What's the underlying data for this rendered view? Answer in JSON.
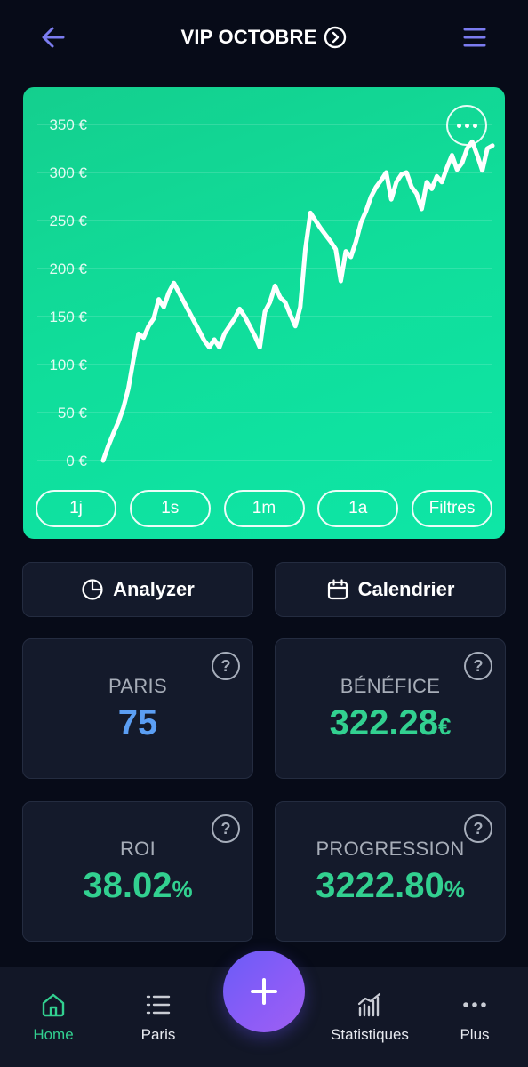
{
  "header": {
    "title": "VIP OCTOBRE",
    "back_icon": "arrow-left-icon",
    "title_icon": "chevron-right-circle-icon",
    "menu_icon": "menu-icon",
    "accent_color": "#7b7cf0"
  },
  "chart_data": {
    "type": "line",
    "title": "",
    "xlabel": "",
    "ylabel": "",
    "ylim": [
      0,
      350
    ],
    "y_ticks": [
      "0 €",
      "50 €",
      "100 €",
      "150 €",
      "200 €",
      "250 €",
      "300 €",
      "350 €"
    ],
    "grid": true,
    "line_color": "#ffffff",
    "background_color": "#10dd9a",
    "series": [
      {
        "values": [
          0,
          15,
          28,
          40,
          55,
          75,
          105,
          132,
          128,
          140,
          148,
          168,
          160,
          175,
          185,
          175,
          165,
          155,
          145,
          135,
          125,
          118,
          126,
          118,
          132,
          140,
          148,
          158,
          150,
          140,
          130,
          118,
          155,
          165,
          182,
          170,
          165,
          152,
          140,
          160,
          220,
          258,
          250,
          242,
          235,
          228,
          220,
          187,
          218,
          212,
          228,
          248,
          260,
          275,
          285,
          292,
          300,
          272,
          290,
          298,
          300,
          285,
          278,
          262,
          290,
          283,
          296,
          290,
          305,
          318,
          303,
          310,
          325,
          332,
          318,
          302,
          325,
          328
        ]
      }
    ]
  },
  "chart_controls": {
    "more_icon": "more-horizontal-icon",
    "ranges": [
      "1j",
      "1s",
      "1m",
      "1a",
      "Filtres"
    ]
  },
  "actions": {
    "analyzer": {
      "label": "Analyzer",
      "icon": "pie-chart-icon"
    },
    "calendar": {
      "label": "Calendrier",
      "icon": "calendar-icon"
    }
  },
  "stats": {
    "paris": {
      "label": "PARIS",
      "value": "75"
    },
    "benefice": {
      "label": "BÉNÉFICE",
      "value": "322.28",
      "unit": "€"
    },
    "roi": {
      "label": "ROI",
      "value": "38.02",
      "unit": "%"
    },
    "progression": {
      "label": "PROGRESSION",
      "value": "3222.80",
      "unit": "%"
    },
    "help_icon": "question-circle-icon",
    "help_glyph": "?"
  },
  "nav": {
    "home": {
      "label": "Home",
      "icon": "home-icon"
    },
    "paris": {
      "label": "Paris",
      "icon": "list-icon"
    },
    "add": {
      "icon": "plus-icon"
    },
    "stats": {
      "label": "Statistiques",
      "icon": "bar-chart-icon"
    },
    "more": {
      "label": "Plus",
      "icon": "more-horizontal-icon"
    }
  },
  "colors": {
    "background": "#070b18",
    "card": "#141a2b",
    "positive": "#32d090",
    "blue_value": "#5b9ef3",
    "fab_gradient_start": "#6a5cf7",
    "fab_gradient_end": "#9f5ff2"
  }
}
